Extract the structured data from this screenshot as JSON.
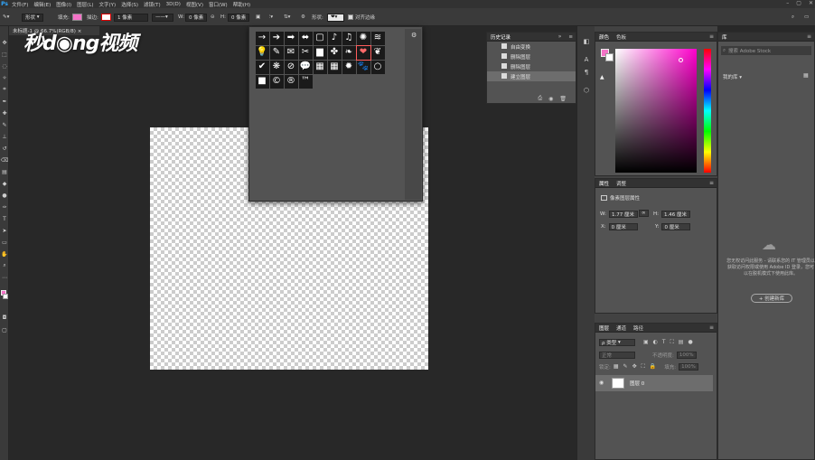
{
  "menubar": {
    "logo": "Ps",
    "items": [
      "文件(F)",
      "编辑(E)",
      "图像(I)",
      "图层(L)",
      "文字(Y)",
      "选择(S)",
      "滤镜(T)",
      "3D(D)",
      "视图(V)",
      "窗口(W)",
      "帮助(H)"
    ],
    "window_controls": [
      "–",
      "▢",
      "✕"
    ]
  },
  "optionsbar": {
    "mode": "形状",
    "fill_label": "填充:",
    "stroke_label": "描边:",
    "stroke_width": "1 像素",
    "w_label": "W:",
    "w_value": "0 像素",
    "link": "⊝",
    "h_label": "H:",
    "h_value": "0 像素",
    "shape_label": "形状:",
    "align_edges_label": "对齐边缘",
    "fill_color": "#f472c7"
  },
  "doc": {
    "tab": "未标题-1 @ 66.7%(RGB/8) ×"
  },
  "watermark": "秒d◉ng视频",
  "shapepicker": {
    "shapes": [
      "→",
      "➔",
      "➡",
      "⬌",
      "▢",
      "♪",
      "♫",
      "✺",
      "≋",
      "💡",
      "✎",
      "✉",
      "✂",
      "▆",
      "✤",
      "❧",
      "❤",
      "❦",
      "✔",
      "❋",
      "⊘",
      "💬",
      "▦",
      "▦",
      "✹",
      "🐾",
      "○",
      "■",
      "©",
      "®",
      "™"
    ],
    "gear": "⚙"
  },
  "history": {
    "tabs": [
      "历史记录"
    ],
    "collapse": "»",
    "menu": "≡",
    "items": [
      "自由变换",
      "删除图层",
      "删除图层",
      "建立图层"
    ],
    "footer": [
      "⎙",
      "◉",
      "🗑"
    ]
  },
  "dock": [
    "◧",
    "A",
    "¶",
    "⬡"
  ],
  "color": {
    "tabs": [
      "颜色",
      "色板"
    ],
    "menu": "≡",
    "warning": "▲",
    "fg": "#f472c7",
    "bg": "#ffffff"
  },
  "properties": {
    "tabs": [
      "属性",
      "调整"
    ],
    "menu": "≡",
    "title": "像素图层属性",
    "w_label": "W:",
    "w_value": "1.77 厘米",
    "link": "∞",
    "h_label": "H:",
    "h_value": "1.46 厘米",
    "x_label": "X:",
    "x_value": "0 厘米",
    "y_label": "Y:",
    "y_value": "0 厘米"
  },
  "layers": {
    "tabs": [
      "图层",
      "通道",
      "路径"
    ],
    "menu": "≡",
    "filter_label": "ρ 类型",
    "filter_icons": [
      "▣",
      "◐",
      "T",
      "⛶",
      "▤",
      "●"
    ],
    "blend_mode": "正常",
    "opacity_label": "不透明度:",
    "opacity_value": "100%",
    "lock_label": "锁定:",
    "lock_icons": [
      "▦",
      "✎",
      "✥",
      "⛶",
      "🔒"
    ],
    "fill_label": "填充:",
    "fill_value": "100%",
    "layer_name": "图层 0",
    "eye": "◉"
  },
  "library": {
    "tabs": [
      "库"
    ],
    "menu": "≡",
    "search_placeholder": "搜索 Adobe Stock",
    "dropdown": "我的库 ▾",
    "view_icon": "▦",
    "cloud": "☁",
    "message": "您无权访问此服务 - 请联系您的 IT 管理员以获取访问权限或使用 Adobe ID 登录，您可以在脱机模式下使用此库。",
    "create_button": "+ 创建新库"
  }
}
